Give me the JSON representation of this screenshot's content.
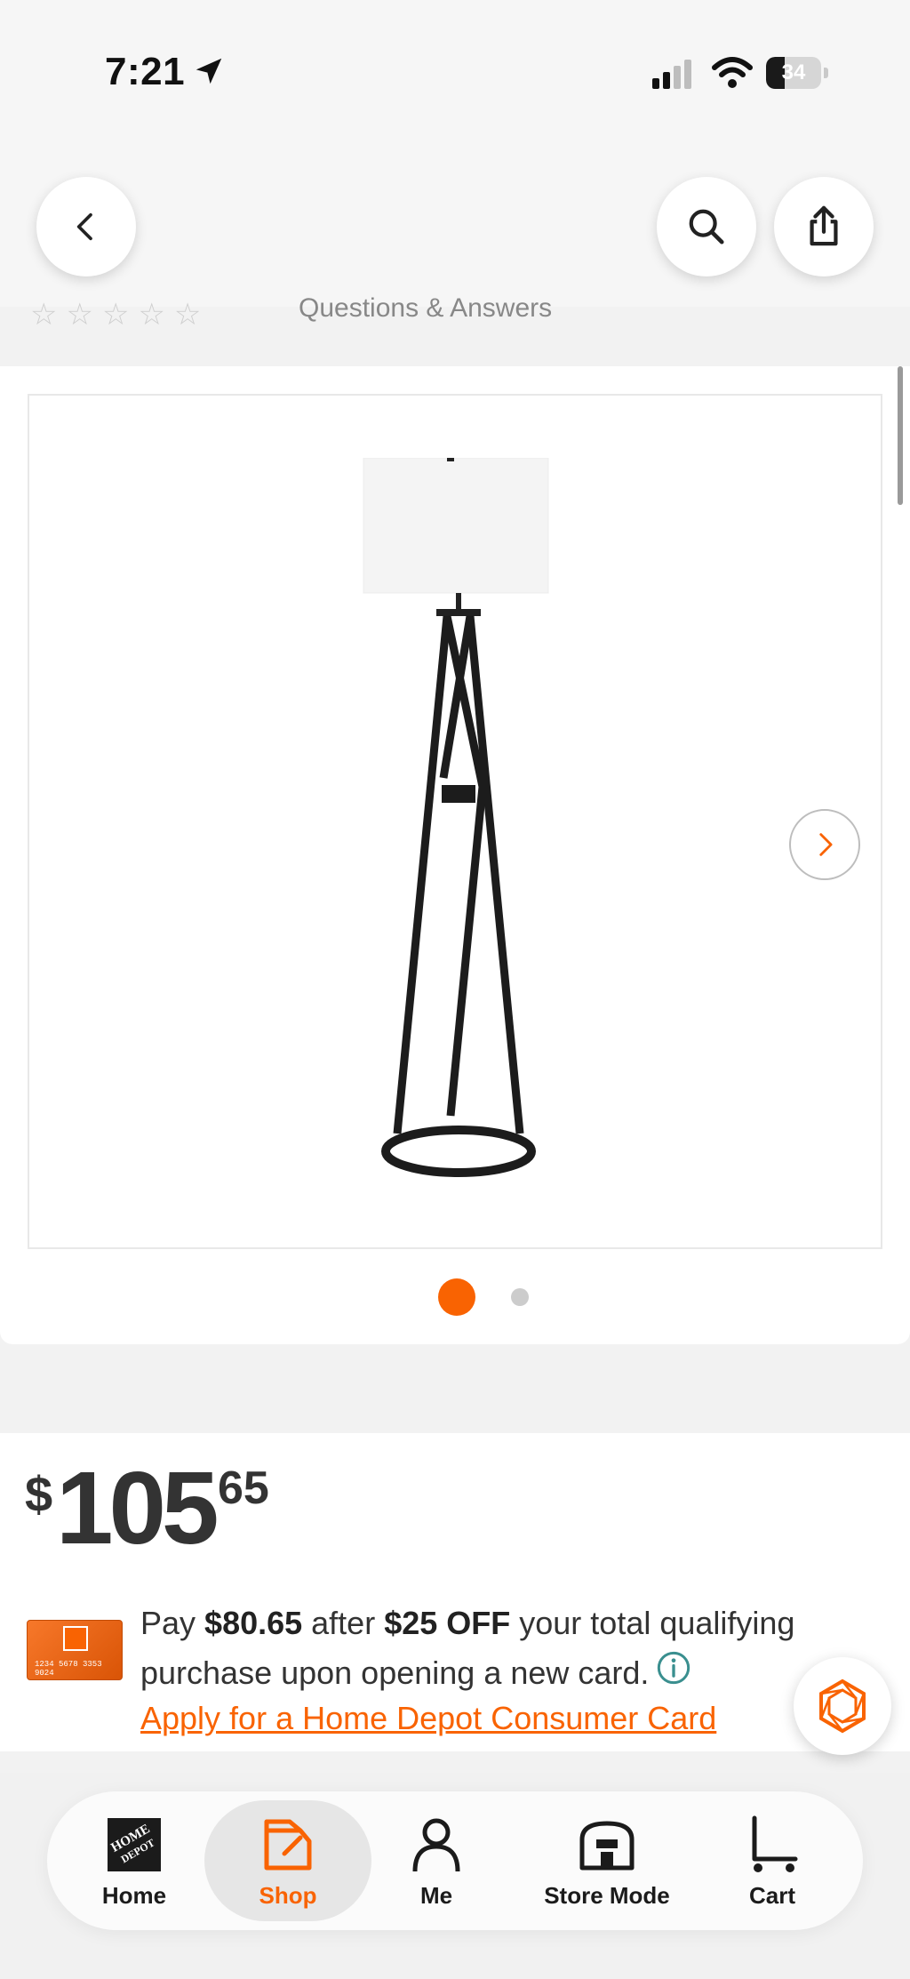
{
  "status_bar": {
    "time": "7:21",
    "battery": "34",
    "battery_level": 0.34
  },
  "header": {
    "back_icon": "chevron-left-icon",
    "search_icon": "search-icon",
    "share_icon": "share-icon"
  },
  "faded_row": {
    "qa_label": "Questions & Answers"
  },
  "gallery": {
    "image": "floor-lamp",
    "slide_count": 2,
    "active_slide": 1,
    "next_icon": "chevron-right-icon"
  },
  "price": {
    "currency": "$",
    "dollars": "105",
    "cents": "65"
  },
  "offer": {
    "pay_prefix": "Pay ",
    "pay_amount": "$80.65",
    "after": " after ",
    "discount": "$25 OFF",
    "rest": " your total qualifying purchase upon opening a new card.",
    "apply_link": "Apply for a Home Depot Consumer Card",
    "card_number": "1234 5678 3353 9024"
  },
  "colors": {
    "brand_orange": "#f96302"
  },
  "tabs": [
    {
      "label": "Home",
      "icon": "home-depot-logo-icon",
      "active": false
    },
    {
      "label": "Shop",
      "icon": "shop-icon",
      "active": true
    },
    {
      "label": "Me",
      "icon": "person-icon",
      "active": false
    },
    {
      "label": "Store Mode",
      "icon": "store-icon",
      "active": false
    },
    {
      "label": "Cart",
      "icon": "cart-icon",
      "active": false
    }
  ]
}
